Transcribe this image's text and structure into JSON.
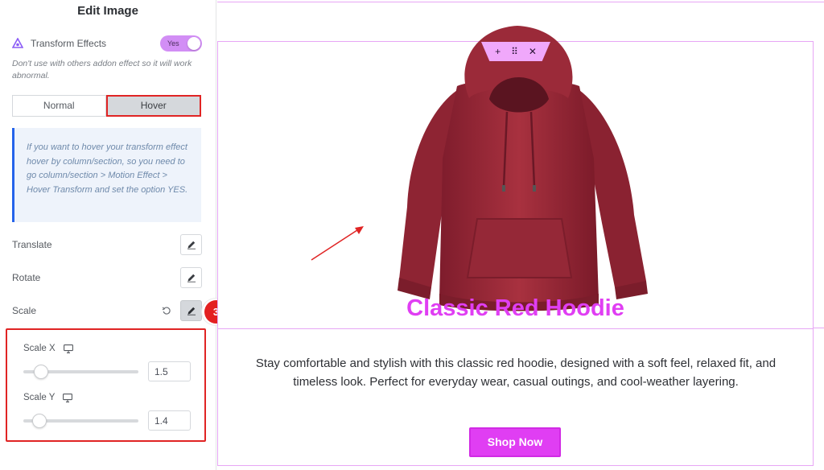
{
  "panel": {
    "title": "Edit Image",
    "transform_effects_label": "Transform Effects",
    "transform_effects_toggle": "Yes",
    "warning_note": "Don't use with others addon effect so it will work abnormal.",
    "tabs": [
      {
        "label": "Normal",
        "active": false
      },
      {
        "label": "Hover",
        "active": true
      }
    ],
    "info_text": "If you want to hover your transform effect hover by column/section, so you need to go column/section > Motion Effect > Hover Transform and set the option YES.",
    "controls": [
      {
        "label": "Translate",
        "icon": "pencil-icon"
      },
      {
        "label": "Rotate",
        "icon": "pencil-icon"
      },
      {
        "label": "Scale",
        "icon": "pencil-icon",
        "has_reset": true,
        "active": true
      }
    ],
    "scale_popover": {
      "scale_x_label": "Scale X",
      "scale_x_value": "1.5",
      "scale_x_slider_fraction": 0.1,
      "scale_y_label": "Scale Y",
      "scale_y_value": "1.4",
      "scale_y_slider_fraction": 0.09
    },
    "partially_hidden_label": "Transform",
    "step_badge": "3",
    "collapse_icon": "chevron-left-icon"
  },
  "canvas": {
    "handle_icons": [
      "plus-icon",
      "drag-handle-icon",
      "close-icon"
    ],
    "handle_glyphs": [
      "+",
      "⠿",
      "✕"
    ],
    "product_title": "Classic Red Hoodie",
    "description": "Stay comfortable and stylish with this classic red hoodie, designed with a soft feel, relaxed fit, and timeless look. Perfect for everyday wear, casual outings, and cool-weather layering.",
    "button_label": "Shop Now"
  },
  "colors": {
    "accent_pink": "#e03ef3",
    "toggle_bg": "#d28ef5",
    "annotation_red": "#e02424",
    "info_border": "#2563eb",
    "hoodie": "#a02838"
  }
}
